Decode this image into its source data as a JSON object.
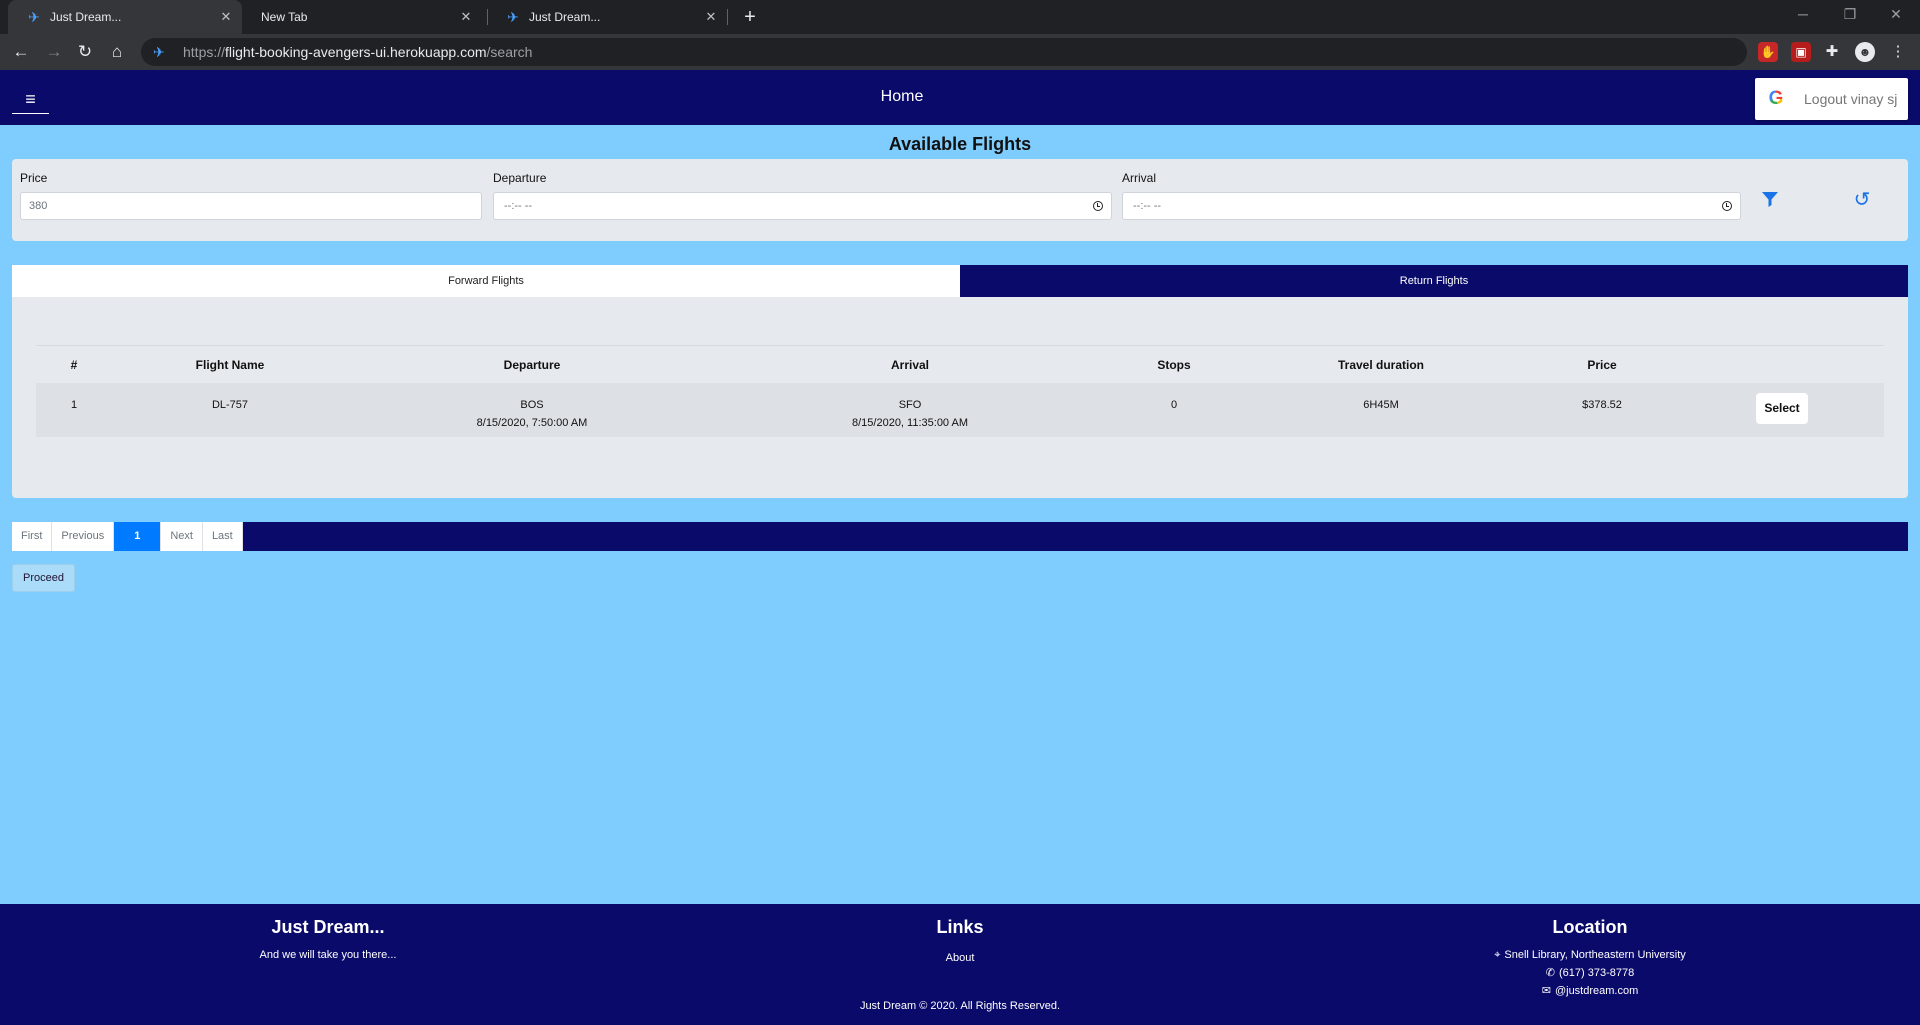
{
  "browser": {
    "tabs": [
      {
        "title": "Just Dream...",
        "active": true
      },
      {
        "title": "New Tab",
        "active": false
      },
      {
        "title": "Just Dream...",
        "active": false
      }
    ],
    "url": {
      "scheme": "https://",
      "host": "flight-booking-avengers-ui.herokuapp.com",
      "path": "/search"
    }
  },
  "navbar": {
    "menu_icon": "hamburger-icon",
    "home_label": "Home",
    "logout_label": "Logout vinay sj",
    "brand_colors": {
      "navbar": "#0a0a6b",
      "page_bg": "#7fcdff",
      "accent": "#007bff"
    }
  },
  "page": {
    "title": "Available Flights"
  },
  "filters": {
    "price_label": "Price",
    "price_value": "380",
    "departure_label": "Departure",
    "departure_value": "--:-- --",
    "arrival_label": "Arrival",
    "arrival_value": "--:-- --"
  },
  "flight_tabs": {
    "forward": "Forward Flights",
    "return": "Return Flights"
  },
  "table": {
    "headers": [
      "#",
      "Flight Name",
      "Departure",
      "Arrival",
      "Stops",
      "Travel duration",
      "Price",
      ""
    ],
    "rows": [
      {
        "num": "1",
        "flight": "DL-757",
        "dep_airport": "BOS",
        "dep_time": "8/15/2020, 7:50:00 AM",
        "arr_airport": "SFO",
        "arr_time": "8/15/2020, 11:35:00 AM",
        "stops": "0",
        "duration": "6H45M",
        "price": "$378.52",
        "action": "Select"
      }
    ]
  },
  "pagination": {
    "first": "First",
    "previous": "Previous",
    "current": "1",
    "next": "Next",
    "last": "Last"
  },
  "proceed_label": "Proceed",
  "footer": {
    "brand_title": "Just Dream...",
    "brand_tagline": "And we will take you there...",
    "links_title": "Links",
    "about": "About",
    "location_title": "Location",
    "address": "Snell Library, Northeastern University",
    "phone": "(617) 373-8778",
    "email": "@justdream.com",
    "copyright_name": "Just Dream",
    "copyright_year": "2020. All Rights Reserved."
  }
}
